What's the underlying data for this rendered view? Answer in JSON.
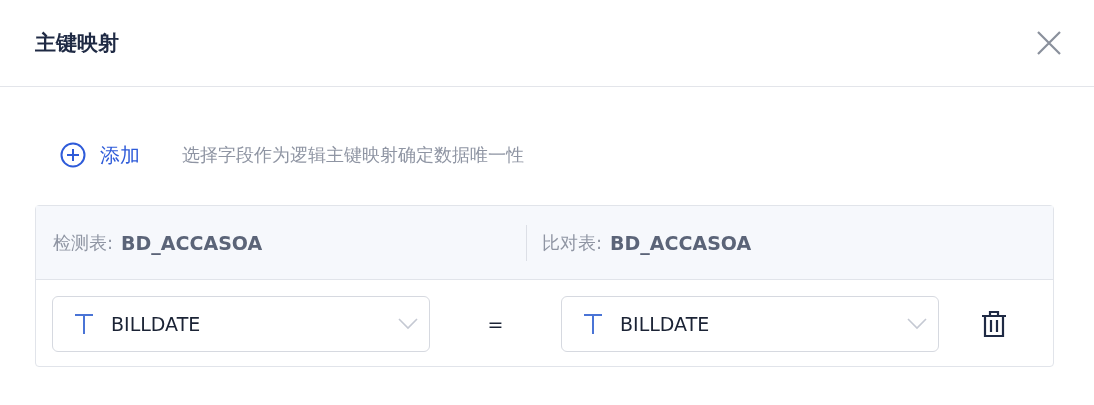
{
  "dialog": {
    "title": "主键映射"
  },
  "add_button": {
    "label": "添加"
  },
  "hint": "选择字段作为逻辑主键映射确定数据唯一性",
  "table": {
    "headers": [
      {
        "label": "检测表:",
        "value": "BD_ACCASOA"
      },
      {
        "label": "比对表:",
        "value": "BD_ACCASOA"
      }
    ],
    "rows": [
      {
        "left": {
          "value": "BILLDATE"
        },
        "operator": "=",
        "right": {
          "value": "BILLDATE"
        }
      }
    ]
  }
}
